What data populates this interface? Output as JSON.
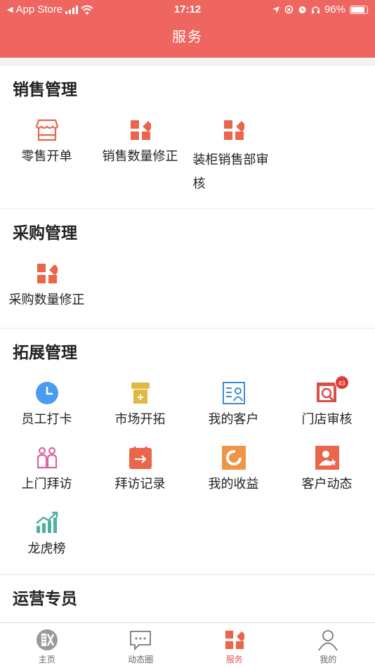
{
  "status_bar": {
    "carrier": "App Store",
    "time": "17:12",
    "battery": "96%"
  },
  "nav": {
    "title": "服务"
  },
  "sections": [
    {
      "title": "销售管理",
      "items": [
        {
          "label": "零售开单",
          "icon": "store-icon"
        },
        {
          "label": "销售数量修正",
          "icon": "grid-diamond-icon"
        },
        {
          "label": "装柜销售部审核",
          "icon": "grid-diamond-icon"
        }
      ]
    },
    {
      "title": "采购管理",
      "items": [
        {
          "label": "采购数量修正",
          "icon": "grid-diamond-icon"
        }
      ]
    },
    {
      "title": "拓展管理",
      "items": [
        {
          "label": "员工打卡",
          "icon": "clock-icon"
        },
        {
          "label": "市场开拓",
          "icon": "market-icon"
        },
        {
          "label": "我的客户",
          "icon": "customer-card-icon"
        },
        {
          "label": "门店审核",
          "icon": "store-review-icon",
          "badge": "43"
        },
        {
          "label": "上门拜访",
          "icon": "visit-people-icon"
        },
        {
          "label": "拜访记录",
          "icon": "calendar-arrow-icon"
        },
        {
          "label": "我的收益",
          "icon": "earnings-icon"
        },
        {
          "label": "客户动态",
          "icon": "customer-star-icon"
        },
        {
          "label": "龙虎榜",
          "icon": "trend-chart-icon"
        }
      ]
    },
    {
      "title": "运营专员",
      "items": []
    }
  ],
  "tabs": [
    {
      "label": "主页",
      "icon": "home-icon",
      "active": false
    },
    {
      "label": "动态圈",
      "icon": "chat-icon",
      "active": false
    },
    {
      "label": "服务",
      "icon": "service-grid-icon",
      "active": true
    },
    {
      "label": "我的",
      "icon": "user-icon",
      "active": false
    }
  ],
  "colors": {
    "accent": "#ef6660",
    "icon_orange": "#e9654b",
    "clock_blue": "#4a9cf0",
    "market_gold": "#e2b845",
    "visit_pink": "#d66aa0",
    "trend_green": "#4fb0a0"
  }
}
